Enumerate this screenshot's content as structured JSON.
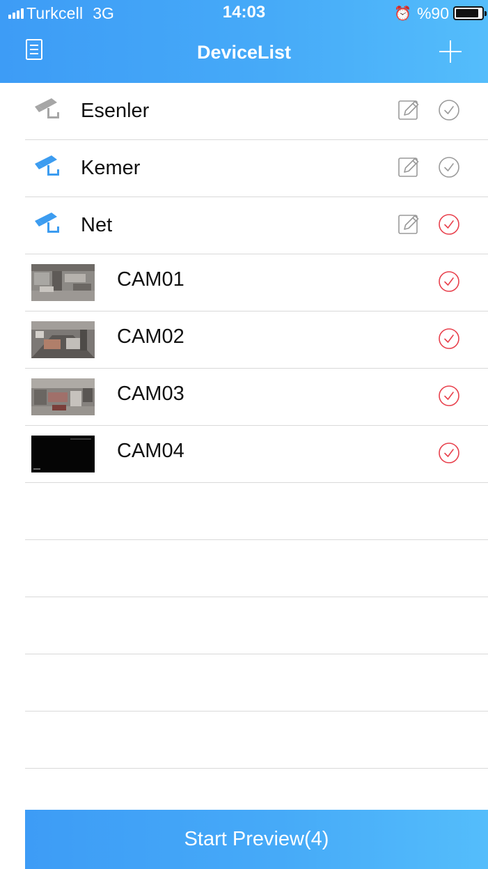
{
  "status_bar": {
    "carrier": "Turkcell",
    "network": "3G",
    "time": "14:03",
    "battery": "%90",
    "battery_level": 0.9
  },
  "navbar": {
    "title": "DeviceList",
    "menu_icon": "list-document-icon",
    "add_icon": "plus-icon"
  },
  "devices": [
    {
      "label": "Esenler",
      "icon": "cctv-camera-icon",
      "icon_color": "#a6a6a6",
      "selected": false
    },
    {
      "label": "Kemer",
      "icon": "cctv-camera-icon",
      "icon_color": "#3c9cf0",
      "selected": false
    },
    {
      "label": "Net",
      "icon": "cctv-camera-icon",
      "icon_color": "#3c9cf0",
      "selected": true
    }
  ],
  "channels": [
    {
      "label": "CAM01",
      "selected": true
    },
    {
      "label": "CAM02",
      "selected": true
    },
    {
      "label": "CAM03",
      "selected": true
    },
    {
      "label": "CAM04",
      "selected": true
    }
  ],
  "bottom_button": {
    "label": "Start Preview(4)"
  },
  "colors": {
    "header_blue": "#46aaf8",
    "check_selected": "#e8404c",
    "check_unselected": "#9a9a9a",
    "divider": "#d9d9d9"
  }
}
